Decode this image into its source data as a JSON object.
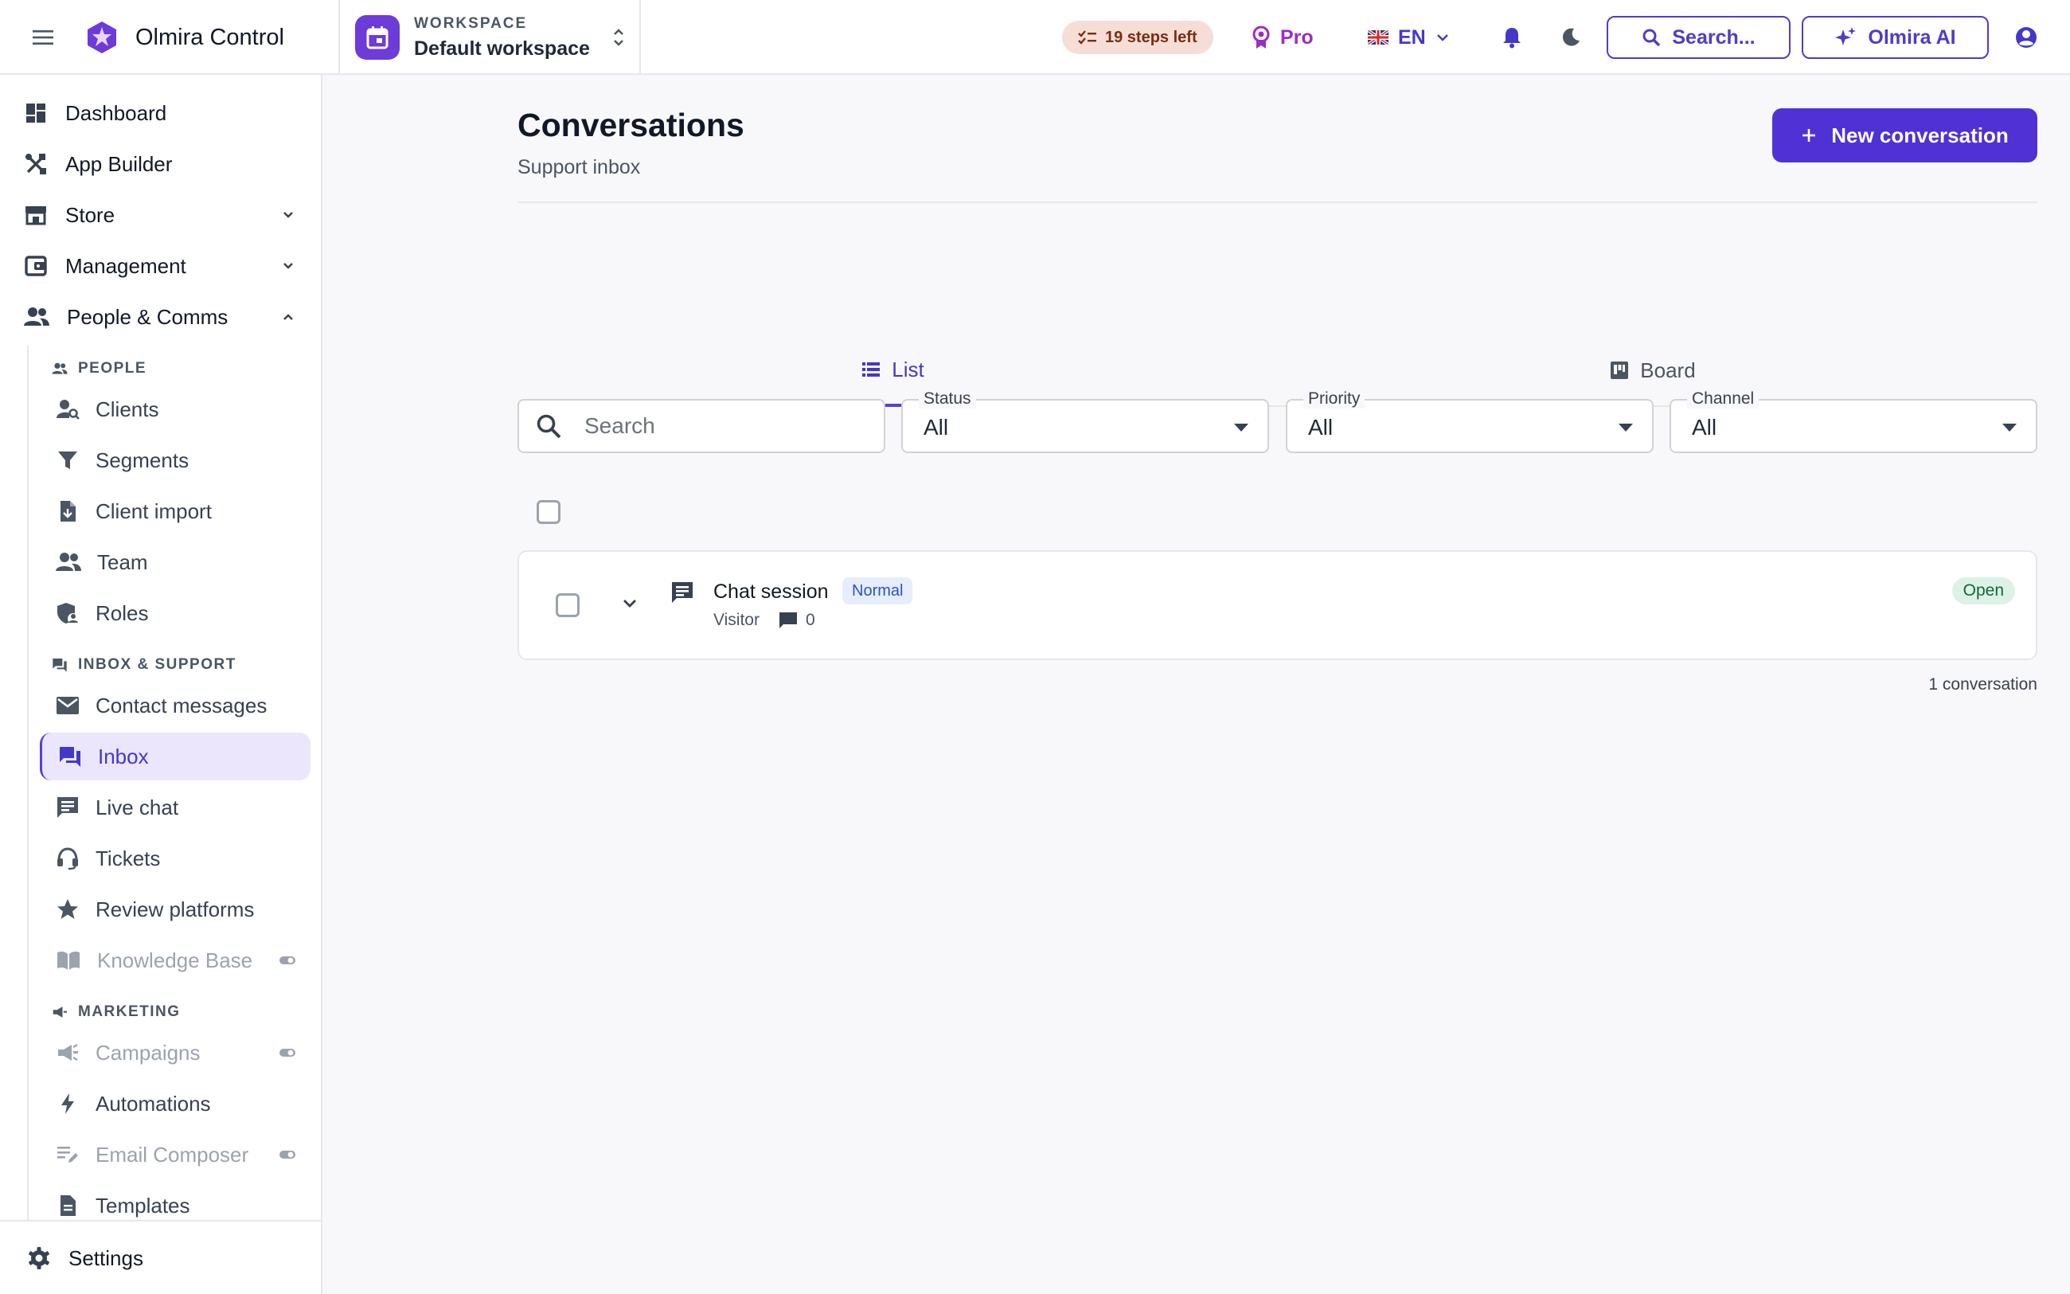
{
  "app": {
    "brand_name": "Olmira Control",
    "workspace_label": "WORKSPACE",
    "workspace_name": "Default workspace",
    "steps_badge": "19 steps left",
    "plan": "Pro",
    "language": "EN",
    "search_label": "Search...",
    "ai_label": "Olmira AI"
  },
  "colors": {
    "accent": "#4f31d6",
    "active_nav_bg": "#ebe6fb",
    "brand_icon": "#6d3bd8",
    "steps_bg": "#f6ded6",
    "status_open_bg": "#dcf2e6",
    "priority_normal_bg": "#e6edfc"
  },
  "sidebar": {
    "top_items": [
      {
        "label": "Dashboard",
        "icon": "dashboard-icon"
      },
      {
        "label": "App Builder",
        "icon": "tools-icon"
      },
      {
        "label": "Store",
        "icon": "store-icon",
        "expanded": false
      },
      {
        "label": "Management",
        "icon": "wallet-icon",
        "expanded": false
      },
      {
        "label": "People & Comms",
        "icon": "people-icon",
        "expanded": true
      }
    ],
    "sections": {
      "people": "PEOPLE",
      "inbox": "INBOX & SUPPORT",
      "marketing": "MARKETING"
    },
    "people_items": [
      {
        "label": "Clients",
        "icon": "person-search-icon"
      },
      {
        "label": "Segments",
        "icon": "filter-icon"
      },
      {
        "label": "Client import",
        "icon": "file-import-icon"
      },
      {
        "label": "Team",
        "icon": "group-icon"
      },
      {
        "label": "Roles",
        "icon": "shield-person-icon"
      }
    ],
    "inbox_items": [
      {
        "label": "Contact messages",
        "icon": "mail-icon"
      },
      {
        "label": "Inbox",
        "icon": "forum-icon",
        "active": true
      },
      {
        "label": "Live chat",
        "icon": "chat-icon"
      },
      {
        "label": "Tickets",
        "icon": "headset-icon"
      },
      {
        "label": "Review platforms",
        "icon": "star-icon"
      },
      {
        "label": "Knowledge Base",
        "icon": "book-icon",
        "disabled": true
      }
    ],
    "marketing_items": [
      {
        "label": "Campaigns",
        "icon": "campaign-icon",
        "disabled": true
      },
      {
        "label": "Automations",
        "icon": "bolt-icon"
      },
      {
        "label": "Email Composer",
        "icon": "edit-note-icon",
        "disabled": true
      },
      {
        "label": "Templates",
        "icon": "document-icon"
      }
    ],
    "settings_label": "Settings"
  },
  "page": {
    "title": "Conversations",
    "subtitle": "Support inbox",
    "new_button": "New conversation",
    "tabs": [
      {
        "label": "List",
        "icon": "list-icon",
        "active": true
      },
      {
        "label": "Board",
        "icon": "board-icon",
        "active": false
      }
    ],
    "filters": {
      "search_placeholder": "Search",
      "status": {
        "label": "Status",
        "value": "All"
      },
      "priority": {
        "label": "Priority",
        "value": "All"
      },
      "channel": {
        "label": "Channel",
        "value": "All"
      }
    },
    "conversations": [
      {
        "title": "Chat session",
        "priority": "Normal",
        "from": "Visitor",
        "message_count": "0",
        "status": "Open"
      }
    ],
    "total_label": "1 conversation"
  }
}
